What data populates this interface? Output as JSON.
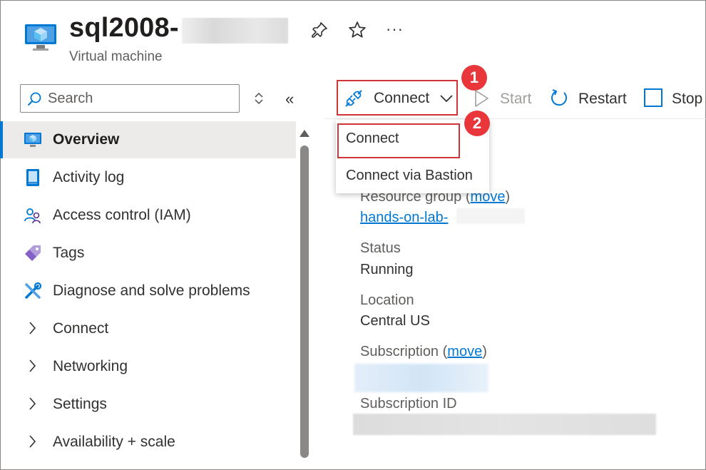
{
  "header": {
    "title": "sql2008-",
    "subtitle": "Virtual machine",
    "more_label": "···",
    "icons": [
      "virtual-machine-icon",
      "pin-icon",
      "star-icon",
      "more-icon"
    ]
  },
  "search": {
    "placeholder": "Search",
    "value": ""
  },
  "sidebar": {
    "items": [
      {
        "label": "Overview",
        "icon": "overview-icon",
        "selected": true
      },
      {
        "label": "Activity log",
        "icon": "activity-log-icon"
      },
      {
        "label": "Access control (IAM)",
        "icon": "access-control-icon"
      },
      {
        "label": "Tags",
        "icon": "tag-icon"
      },
      {
        "label": "Diagnose and solve problems",
        "icon": "diagnose-icon"
      },
      {
        "label": "Connect",
        "icon": "chevron-right-icon"
      },
      {
        "label": "Networking",
        "icon": "chevron-right-icon"
      },
      {
        "label": "Settings",
        "icon": "chevron-right-icon"
      },
      {
        "label": "Availability + scale",
        "icon": "chevron-right-icon"
      }
    ]
  },
  "toolbar": {
    "connect_label": "Connect",
    "start_label": "Start",
    "restart_label": "Restart",
    "stop_label": "Stop"
  },
  "callouts": {
    "step1": "1",
    "step2": "2"
  },
  "connect_menu": {
    "items": [
      "Connect",
      "Connect via Bastion"
    ]
  },
  "essentials": {
    "resource_group_label": "Resource group (",
    "move_link": "move",
    "close_paren": ")",
    "resource_group_value": "hands-on-lab-",
    "status_label": "Status",
    "status_value": "Running",
    "location_label": "Location",
    "location_value": "Central US",
    "subscription_label": "Subscription (",
    "subscription_id_label": "Subscription ID"
  },
  "colors": {
    "accent": "#0078d4",
    "callout_red": "#e8363a",
    "highlight_border": "#d13438",
    "selected_bg": "#edebe9"
  }
}
